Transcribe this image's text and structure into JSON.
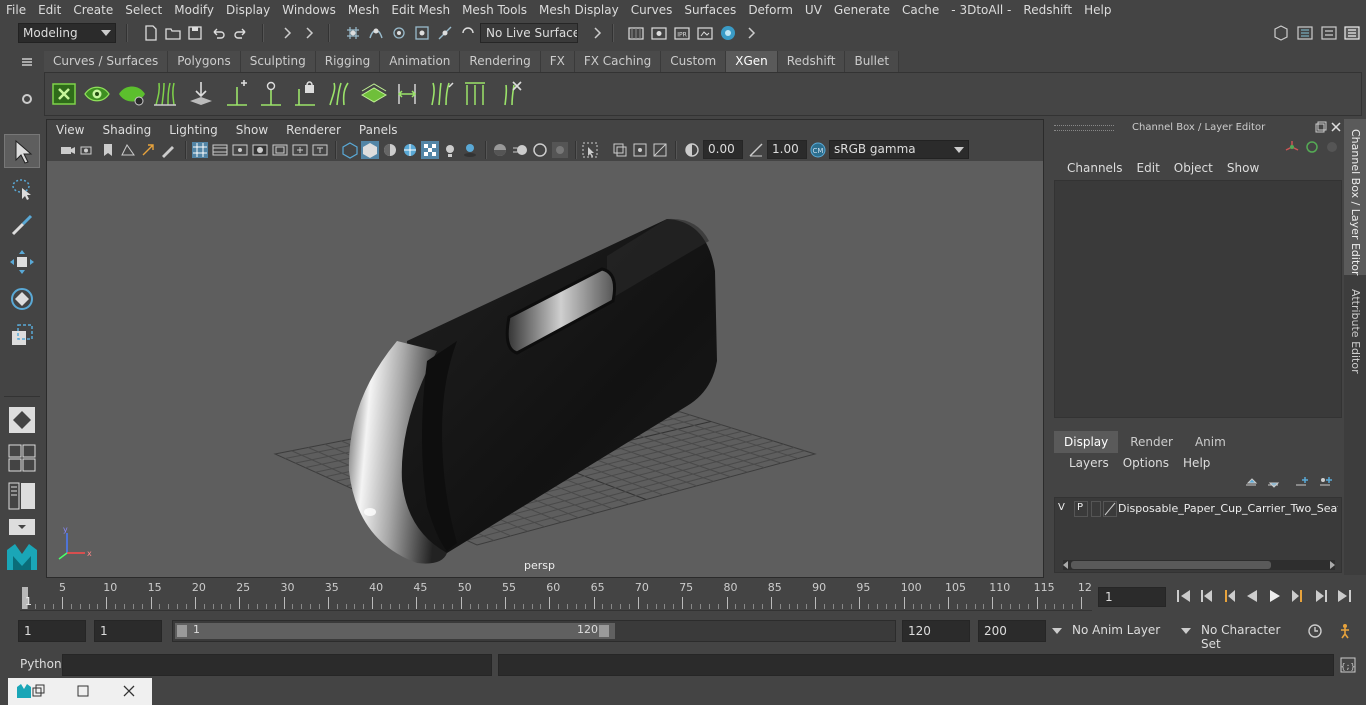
{
  "menubar": {
    "items": [
      "File",
      "Edit",
      "Create",
      "Select",
      "Modify",
      "Display",
      "Windows",
      "Mesh",
      "Edit Mesh",
      "Mesh Tools",
      "Mesh Display",
      "Curves",
      "Surfaces",
      "Deform",
      "UV",
      "Generate",
      "Cache",
      "- 3DtoAll -",
      "Redshift",
      "Help"
    ]
  },
  "status": {
    "workspace": "Modeling",
    "live_surface": "No Live Surface"
  },
  "shelf": {
    "tabs": [
      "Curves / Surfaces",
      "Polygons",
      "Sculpting",
      "Rigging",
      "Animation",
      "Rendering",
      "FX",
      "FX Caching",
      "Custom",
      "XGen",
      "Redshift",
      "Bullet"
    ],
    "active_tab": "XGen"
  },
  "viewport": {
    "menu": [
      "View",
      "Shading",
      "Lighting",
      "Show",
      "Renderer",
      "Panels"
    ],
    "exposure": "0.00",
    "gamma": "1.00",
    "color_space": "sRGB gamma",
    "camera_label": "persp"
  },
  "channelbox": {
    "title": "Channel Box / Layer Editor",
    "menu": [
      "Channels",
      "Edit",
      "Object",
      "Show"
    ],
    "tabs": [
      "Display",
      "Render",
      "Anim"
    ],
    "active_tab": "Display",
    "layer_menu": [
      "Layers",
      "Options",
      "Help"
    ],
    "layer": {
      "v": "V",
      "p": "P",
      "name": "Disposable_Paper_Cup_Carrier_Two_Seats_I"
    }
  },
  "side_tabs": [
    "Channel Box / Layer Editor",
    "Attribute Editor"
  ],
  "timeline": {
    "ticks": [
      "5",
      "10",
      "15",
      "20",
      "25",
      "30",
      "35",
      "40",
      "45",
      "50",
      "55",
      "60",
      "65",
      "70",
      "75",
      "80",
      "85",
      "90",
      "95",
      "100",
      "105",
      "110",
      "115",
      "12"
    ],
    "start_marker": "1",
    "current_frame": "1"
  },
  "range": {
    "start": "1",
    "anim_start": "1",
    "slider_start": "1",
    "slider_end": "120",
    "end": "120",
    "anim_end": "200",
    "anim_layer": "No Anim Layer",
    "char_set": "No Character Set"
  },
  "cmdline": {
    "label": "Python"
  },
  "colors": {
    "accent": "#5285a6",
    "background": "#444444",
    "field": "#2b2b2b",
    "viewport": "#5e5e5e",
    "active_tab": "#5a5a5a",
    "shelf_green": "#6fbf3a"
  }
}
